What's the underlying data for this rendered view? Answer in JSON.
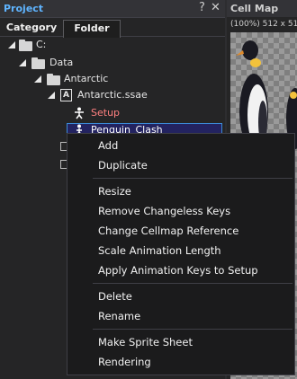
{
  "project": {
    "title": "Project",
    "controls": {
      "help": "?",
      "close": "✕"
    },
    "tabs": [
      {
        "label": "Category"
      },
      {
        "label": "Folder"
      }
    ],
    "tree": [
      {
        "label": "C:",
        "icon": "folder-icon"
      },
      {
        "label": "Data",
        "icon": "folder-icon"
      },
      {
        "label": "Antarctic",
        "icon": "folder-icon"
      },
      {
        "label": "Antarctic.ssae",
        "icon": "animation-file-icon"
      },
      {
        "label": "Setup",
        "icon": "sprite-figure-icon",
        "color": "#ff8080"
      },
      {
        "label": "Penguin_Clash",
        "icon": "sprite-figure-icon",
        "selected": true
      }
    ]
  },
  "cellmap": {
    "title": "Cell Map",
    "info": "(100%) 512 x 512"
  },
  "context_menu": {
    "groups": [
      [
        "Add",
        "Duplicate"
      ],
      [
        "Resize",
        "Remove Changeless Keys",
        "Change Cellmap Reference",
        "Scale Animation Length",
        "Apply Animation Keys to Setup"
      ],
      [
        "Delete",
        "Rename"
      ],
      [
        "Make Sprite Sheet",
        "Rendering"
      ]
    ]
  },
  "colors": {
    "title_accent": "#5fb4ff",
    "selection_border": "#3c8ad6",
    "setup_text": "#ff8080"
  }
}
